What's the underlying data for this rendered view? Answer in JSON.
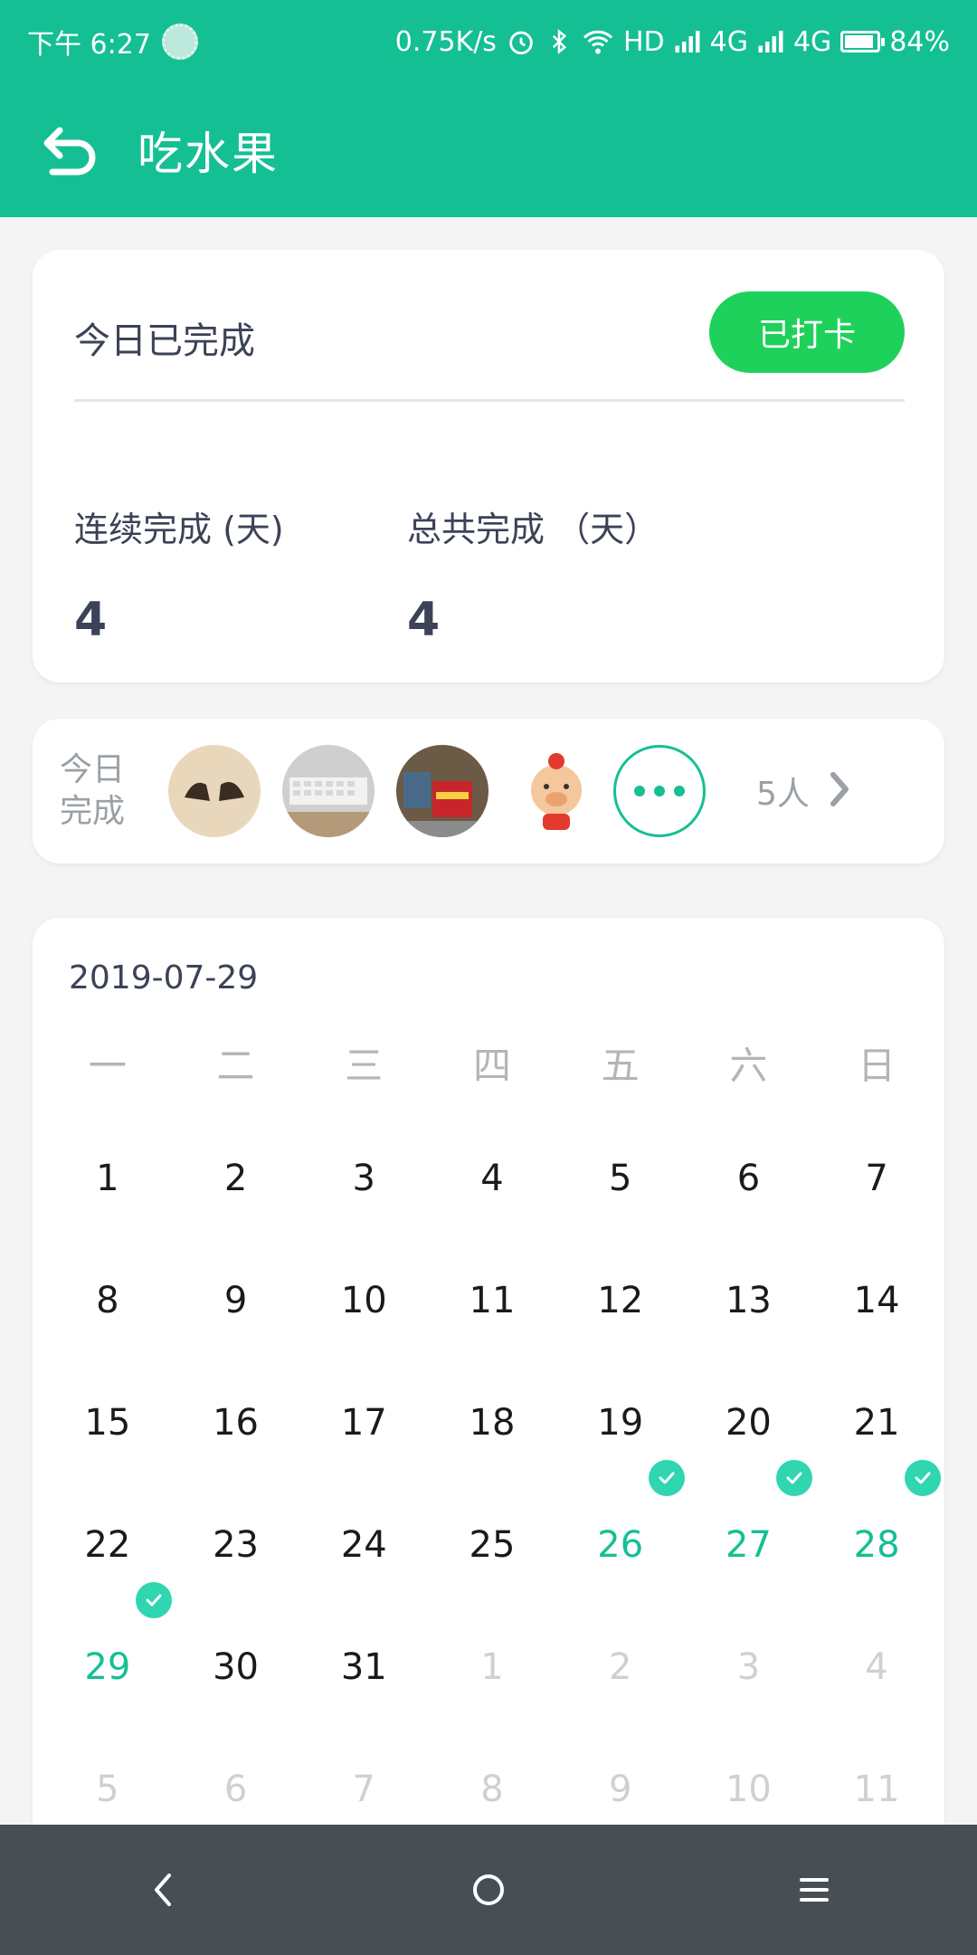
{
  "status_bar": {
    "time": "下午 6:27",
    "speed": "0.75K/s",
    "hd": "HD",
    "net1": "4G",
    "net2": "4G",
    "battery": "84%"
  },
  "app_bar": {
    "title": "吃水果"
  },
  "checkin": {
    "today_label": "今日已完成",
    "button_label": "已打卡",
    "stats": [
      {
        "label": "连续完成 (天)",
        "value": "4"
      },
      {
        "label": "总共完成 （天）",
        "value": "4"
      }
    ]
  },
  "members": {
    "label": "今日完成",
    "count_label": "5人"
  },
  "calendar": {
    "date": "2019-07-29",
    "weekdays": [
      "一",
      "二",
      "三",
      "四",
      "五",
      "六",
      "日"
    ],
    "weeks": [
      [
        "1",
        "2",
        "3",
        "4",
        "5",
        "6",
        "7"
      ],
      [
        "8",
        "9",
        "10",
        "11",
        "12",
        "13",
        "14"
      ],
      [
        "15",
        "16",
        "17",
        "18",
        "19",
        "20",
        "21"
      ],
      [
        "22",
        "23",
        "24",
        "25",
        "26",
        "27",
        "28"
      ],
      [
        "29",
        "30",
        "31",
        "1",
        "2",
        "3",
        "4"
      ],
      [
        "5",
        "6",
        "7",
        "8",
        "9",
        "10",
        "11"
      ]
    ]
  },
  "colors": {
    "primary": "#15bf94",
    "button": "#1ed15a",
    "nav_bar": "#474f54"
  }
}
